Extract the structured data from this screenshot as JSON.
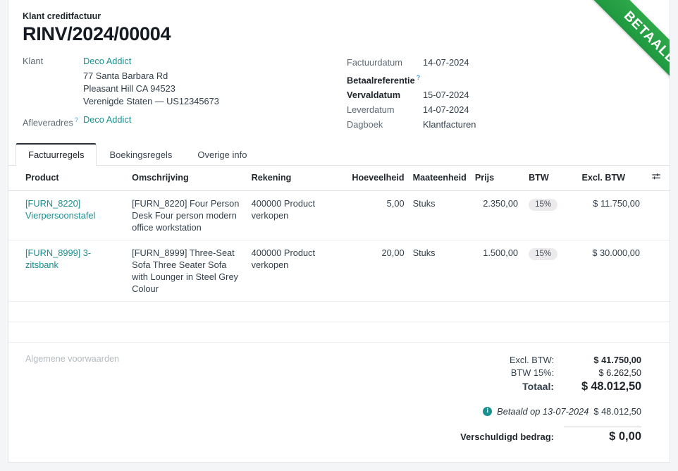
{
  "ribbon": {
    "label": "BETAALD",
    "color": "#28a745"
  },
  "header": {
    "breadcrumb": "Klant creditfactuur",
    "title": "RINV/2024/00004",
    "left_fields": {
      "customer_label": "Klant",
      "customer_name": "Deco Addict",
      "address_line1": "77 Santa Barbara Rd",
      "address_line2": "Pleasant Hill CA 94523",
      "address_line3": "Verenigde Staten — US12345673",
      "delivery_label": "Afleveradres",
      "delivery_help": "?",
      "delivery_value": "Deco Addict"
    },
    "right_fields": [
      {
        "label": "Factuurdatum",
        "value": "14-07-2024",
        "bold": false,
        "help": ""
      },
      {
        "label": "Betaalreferentie",
        "value": "",
        "bold": true,
        "help": "?"
      },
      {
        "label": "Vervaldatum",
        "value": "15-07-2024",
        "bold": true,
        "help": ""
      },
      {
        "label": "Leverdatum",
        "value": "14-07-2024",
        "bold": false,
        "help": ""
      },
      {
        "label": "Dagboek",
        "value": "Klantfacturen",
        "bold": false,
        "help": ""
      }
    ]
  },
  "tabs": [
    {
      "label": "Factuurregels",
      "active": true
    },
    {
      "label": "Boekingsregels",
      "active": false
    },
    {
      "label": "Overige info",
      "active": false
    }
  ],
  "table": {
    "columns": {
      "product": "Product",
      "description": "Omschrijving",
      "account": "Rekening",
      "quantity": "Hoeveelheid",
      "uom": "Maateenheid",
      "price": "Prijs",
      "tax": "BTW",
      "subtotal": "Excl. BTW",
      "config_icon": "column-settings-icon"
    },
    "rows": [
      {
        "product": "[FURN_8220] Vierpersoonstafel",
        "description": "[FURN_8220] Four Person Desk Four person modern office workstation",
        "account": "400000 Product verkopen",
        "quantity": "5,00",
        "uom": "Stuks",
        "price": "2.350,00",
        "tax": "15%",
        "subtotal": "$ 11.750,00"
      },
      {
        "product": "[FURN_8999] 3-zitsbank",
        "description": "[FURN_8999] Three-Seat Sofa Three Seater Sofa with Lounger in Steel Grey Colour",
        "account": "400000 Product verkopen",
        "quantity": "20,00",
        "uom": "Stuks",
        "price": "1.500,00",
        "tax": "15%",
        "subtotal": "$ 30.000,00"
      }
    ],
    "empty_row_count": 2
  },
  "footer": {
    "terms_placeholder": "Algemene voorwaarden",
    "totals": [
      {
        "label": "Excl. BTW:",
        "value": "$ 41.750,00",
        "bold": true
      },
      {
        "label": "BTW 15%:",
        "value": "$ 6.262,50",
        "bold": false
      }
    ],
    "grand_total": {
      "label": "Totaal:",
      "value": "$ 48.012,50"
    },
    "payment": {
      "icon": "info-icon",
      "text": "Betaald op 13-07-2024",
      "amount": "$ 48.012,50"
    },
    "amount_due": {
      "label": "Verschuldigd bedrag:",
      "value": "$ 0,00"
    }
  }
}
